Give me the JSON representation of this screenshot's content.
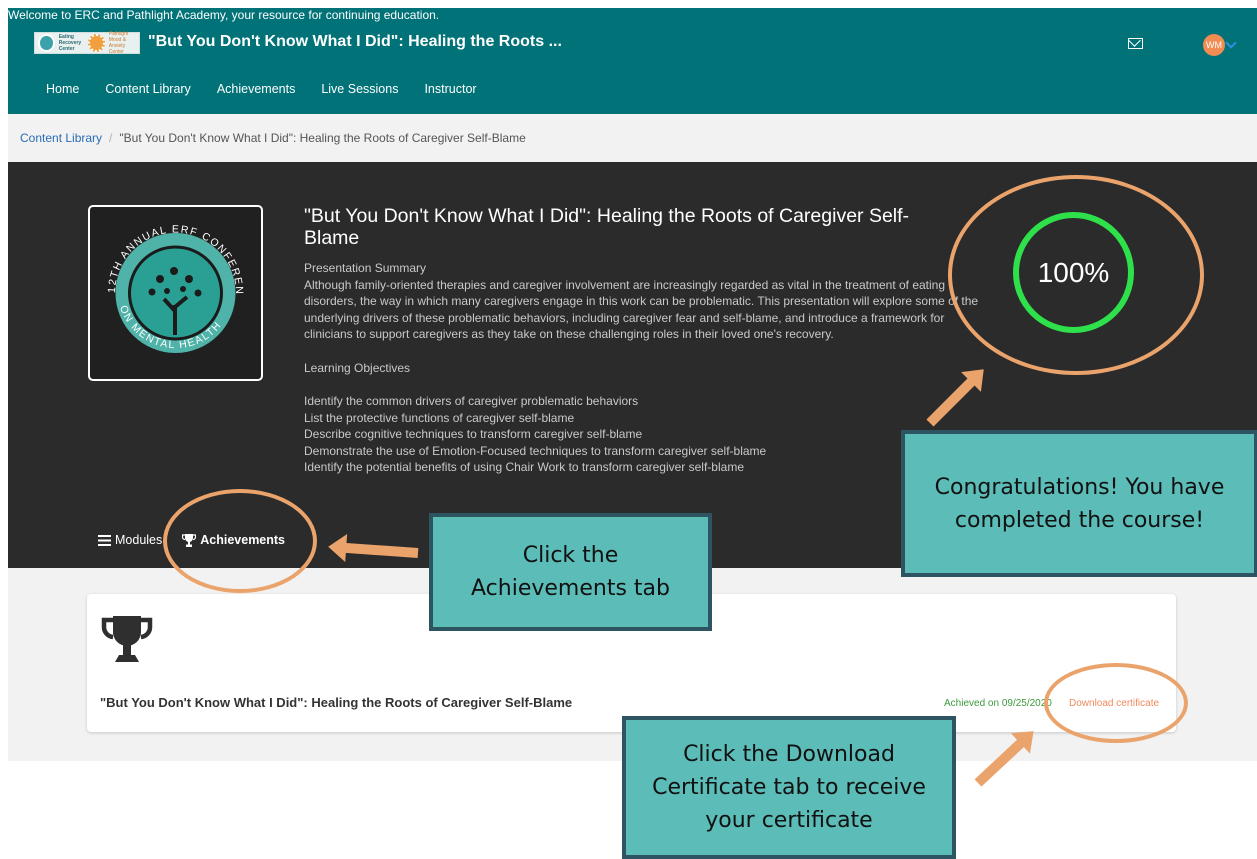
{
  "header": {
    "welcome": "Welcome to ERC and Pathlight Academy, your resource for continuing education.",
    "logo_left_text": "Eating Recovery Center",
    "logo_right_text": "Pathlight Mood & Anxiety Center",
    "course_title": "\"But You Don't Know What I Did\": Healing the Roots ...",
    "avatar_initials": "WM"
  },
  "nav": [
    "Home",
    "Content Library",
    "Achievements",
    "Live Sessions",
    "Instructor"
  ],
  "breadcrumb": {
    "parent": "Content Library",
    "separator": "/",
    "current": "\"But You Don't Know What I Did\": Healing the Roots of Caregiver Self-Blame"
  },
  "course": {
    "image_text_top": "12TH ANNUAL ERF CONFERENCE",
    "image_text_bottom": "ON MENTAL HEALTH",
    "title": "\"But You Don't Know What I Did\": Healing the Roots of Caregiver Self-Blame",
    "summary_heading": "Presentation Summary",
    "summary": "Although family-oriented therapies and caregiver involvement are increasingly regarded as vital in the treatment of eating disorders, the way in which many caregivers engage in this work can be problematic. This presentation will explore some of the underlying drivers of these problematic behaviors, including caregiver fear and self-blame, and introduce a framework for clinicians to support caregivers as they take on these challenging roles in their loved one's recovery.",
    "objectives_heading": "Learning Objectives",
    "objectives": [
      "Identify the common drivers of caregiver problematic behaviors",
      "List the protective functions of caregiver self-blame",
      "Describe cognitive techniques to transform caregiver self-blame",
      "Demonstrate the use of Emotion-Focused techniques to transform caregiver self-blame",
      "Identify the potential benefits of using Chair Work to transform caregiver self-blame"
    ],
    "progress_label": "100%",
    "progress_value": 100,
    "ring_color": "#2ee04a"
  },
  "tabs": {
    "modules": "Modules",
    "achievements": "Achievements"
  },
  "achievement": {
    "title": "\"But You Don't Know What I Did\": Healing the Roots of Caregiver Self-Blame",
    "achieved": "Achieved on 09/25/2020",
    "download": "Download certificate"
  },
  "callouts": {
    "congrats": "Congratulations! You have completed the course!",
    "achievements_tab": "Click the Achievements tab",
    "download": "Click the Download Certificate tab to receive your certificate"
  },
  "colors": {
    "brand_teal": "#007278",
    "hero_bg": "#2b2b2b",
    "annotation": "#eba36c",
    "callout_fill": "#5bbcb8",
    "callout_border": "#2c5461"
  }
}
